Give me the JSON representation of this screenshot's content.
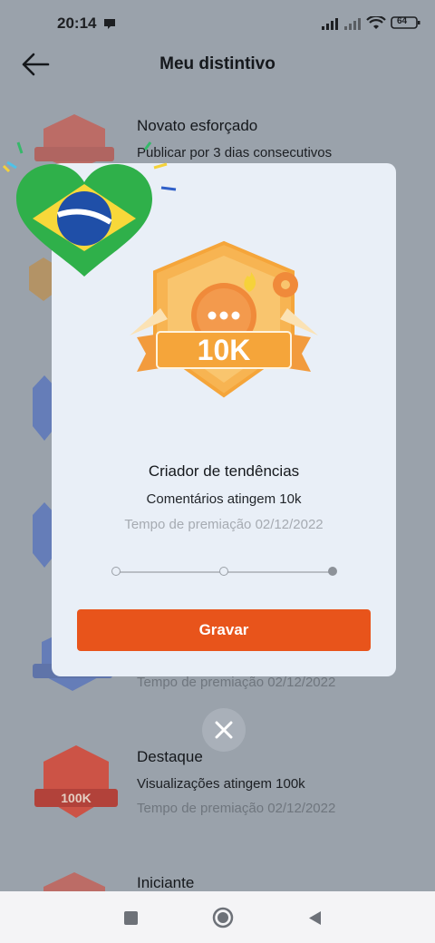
{
  "status_bar": {
    "time": "20:14",
    "battery": "64",
    "icons": [
      "notification-icon",
      "signal-icon",
      "signal-icon",
      "wifi-icon",
      "battery-icon"
    ]
  },
  "header": {
    "title": "Meu distintivo",
    "back_icon": "arrow-left-icon"
  },
  "badges": [
    {
      "title": "Novato esforçado",
      "desc": "Publicar por 3 dias consecutivos"
    },
    {
      "date": "Tempo de premiação 02/12/2022"
    },
    {
      "title": "Destaque",
      "desc": "Visualizações atingem 100k",
      "date": "Tempo de premiação 02/12/2022",
      "badge_text": "100K"
    },
    {
      "title": "Iniciante"
    }
  ],
  "modal": {
    "badge_text": "10K",
    "title": "Criador de tendências",
    "desc": "Comentários atingem 10k",
    "date": "Tempo de premiação 02/12/2022",
    "progress_steps": 3,
    "progress_current": 3,
    "button_label": "Gravar",
    "close_icon": "close-icon"
  },
  "nav_bar": {
    "icons": [
      "square-icon",
      "circle-home-icon",
      "triangle-back-icon"
    ]
  },
  "colors": {
    "accent": "#e8541b",
    "badge_orange": "#f5a53a",
    "badge_red": "#d9402e",
    "badge_blue": "#3b5fc4"
  }
}
